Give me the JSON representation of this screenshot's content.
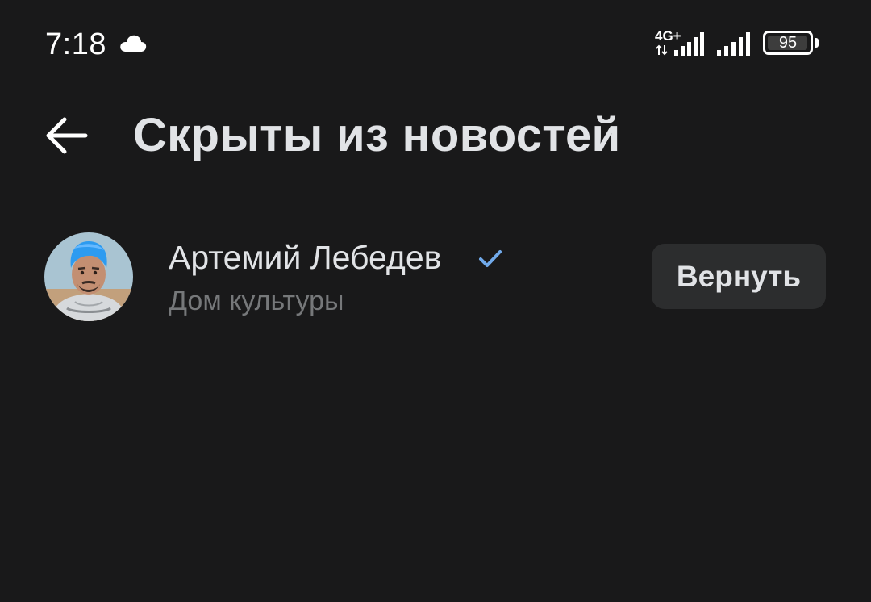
{
  "status_bar": {
    "time": "7:18",
    "network_type": "4G+",
    "battery_level": "95",
    "icons": [
      "cloud-icon",
      "data-arrows-icon",
      "signal-icon",
      "signal-icon",
      "battery-icon"
    ]
  },
  "header": {
    "title": "Скрыты из новостей",
    "back_icon": "arrow-left-icon"
  },
  "hidden_list": [
    {
      "name": "Артемий Лебедев",
      "subtitle": "Дом культуры",
      "verified": true,
      "action_label": "Вернуть"
    }
  ],
  "colors": {
    "background": "#19191a",
    "text_primary": "#e1e3e6",
    "text_secondary": "#76787a",
    "button_bg": "#2c2d2e",
    "verified": "#71aaeb"
  }
}
